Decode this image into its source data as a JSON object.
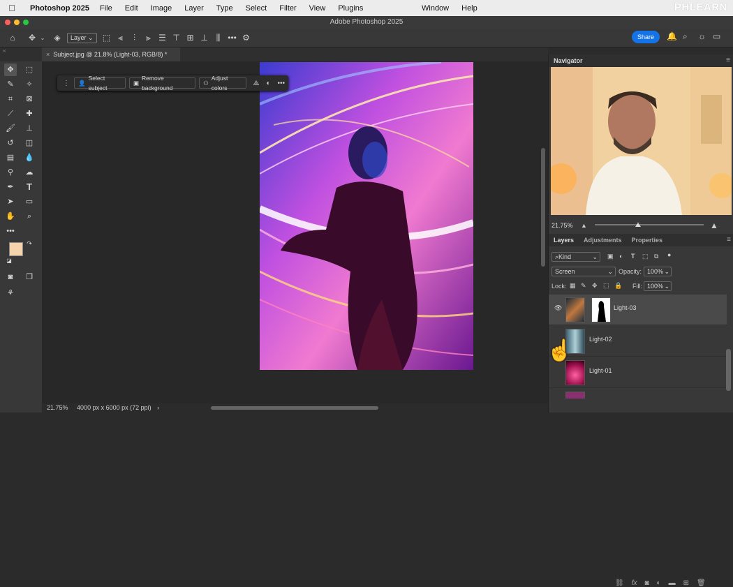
{
  "menubar": {
    "app_name": "Photoshop 2025",
    "items": [
      "File",
      "Edit",
      "Image",
      "Layer",
      "Type",
      "Select",
      "Filter",
      "View",
      "Plugins"
    ],
    "right_items": [
      "Window",
      "Help"
    ],
    "watermark": "PHLEARN"
  },
  "window": {
    "title": "Adobe Photoshop 2025"
  },
  "options_bar": {
    "layer_dropdown": "Layer",
    "share_label": "Share"
  },
  "document_tab": {
    "label": "Subject.jpg @ 21.8% (Light-03, RGB/8) *"
  },
  "sidebar_tab": {
    "label": "«"
  },
  "contextual_bar": {
    "select_subject": "Select subject",
    "remove_background": "Remove background",
    "adjust_colors": "Adjust colors"
  },
  "status_bar": {
    "zoom": "21.75%",
    "doc_info": "4000 px x 6000 px (72 ppi)",
    "arrow": "›"
  },
  "navigator": {
    "title": "Navigator",
    "zoom": "21.75%"
  },
  "layers_panel": {
    "tabs": [
      "Layers",
      "Adjustments",
      "Properties"
    ],
    "kind_filter": "Kind",
    "blend_mode": "Screen",
    "opacity_label": "Opacity:",
    "opacity_value": "100%",
    "lock_label": "Lock:",
    "fill_label": "Fill:",
    "fill_value": "100%",
    "layers": [
      {
        "name": "Light-03",
        "visible": true,
        "selected": true
      },
      {
        "name": "Light-02",
        "visible": false,
        "selected": false
      },
      {
        "name": "Light-01",
        "visible": false,
        "selected": false
      }
    ]
  },
  "colors": {
    "foreground": "#f5d3ad",
    "background": "#000000",
    "accent": "#1473e6"
  }
}
